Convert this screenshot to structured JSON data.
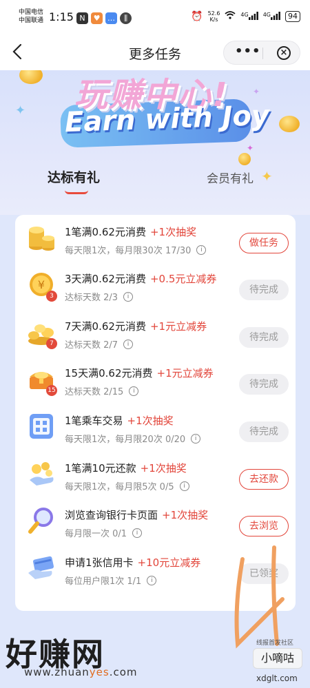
{
  "status_bar": {
    "carrier1": "中国电信",
    "carrier2": "中国联通",
    "time": "1:15",
    "speed": "52.6",
    "speed_unit": "K/s",
    "net1": "4G",
    "net2": "4G",
    "battery": "94"
  },
  "nav": {
    "back_icon": "chevron-left-icon",
    "title": "更多任务",
    "more": "•••",
    "close": "⊗"
  },
  "banner": {
    "title_cn": "玩赚中心!",
    "title_en": "Earn with Joy"
  },
  "tabs": {
    "active": "达标有礼",
    "inactive": "会员有礼"
  },
  "colors": {
    "accent_red": "#e2453a",
    "page_bg": "#dfe7fb"
  },
  "tasks": [
    {
      "icon": "gold-coins-stack-icon",
      "badge": "",
      "title": "1笔满0.62元消费",
      "reward": "+1次抽奖",
      "subtitle": "每天限1次，每月限30次 17/30",
      "button": "做任务",
      "active": true
    },
    {
      "icon": "yuan-coin-icon",
      "badge": "3",
      "title": "3天满0.62元消费",
      "reward": "+0.5元立减券",
      "subtitle": "达标天数 2/3",
      "button": "待完成",
      "active": false
    },
    {
      "icon": "coin-pile-icon",
      "badge": "7",
      "title": "7天满0.62元消费",
      "reward": "+1元立减券",
      "subtitle": "达标天数 2/7",
      "button": "待完成",
      "active": false
    },
    {
      "icon": "treasure-chest-icon",
      "badge": "15",
      "title": "15天满0.62元消费",
      "reward": "+1元立减券",
      "subtitle": "达标天数 2/15",
      "button": "待完成",
      "active": false
    },
    {
      "icon": "transit-card-icon",
      "badge": "",
      "title": "1笔乘车交易",
      "reward": "+1次抽奖",
      "subtitle": "每天限1次，每月限20次 0/20",
      "button": "待完成",
      "active": false
    },
    {
      "icon": "hand-coins-icon",
      "badge": "",
      "title": "1笔满10元还款",
      "reward": "+1次抽奖",
      "subtitle": "每天限1次，每月限5次 0/5",
      "button": "去还款",
      "active": true
    },
    {
      "icon": "magnifier-icon",
      "badge": "",
      "title": "浏览查询银行卡页面",
      "reward": "+1次抽奖",
      "subtitle": "每月限一次 0/1",
      "button": "去浏览",
      "active": true
    },
    {
      "icon": "hand-credit-card-icon",
      "badge": "",
      "title": "申请1张信用卡",
      "reward": "+10元立减券",
      "subtitle": "每位用户限1次 1/1",
      "button": "已领奖",
      "active": false
    }
  ],
  "watermark": {
    "site_cn": "好赚网",
    "site_url_a": "www.zhuan",
    "site_url_b": "yes",
    "site_url_c": ".com",
    "tag": "线报首发社区",
    "logo": "小嘀咕",
    "domain": "xdglt.com"
  }
}
